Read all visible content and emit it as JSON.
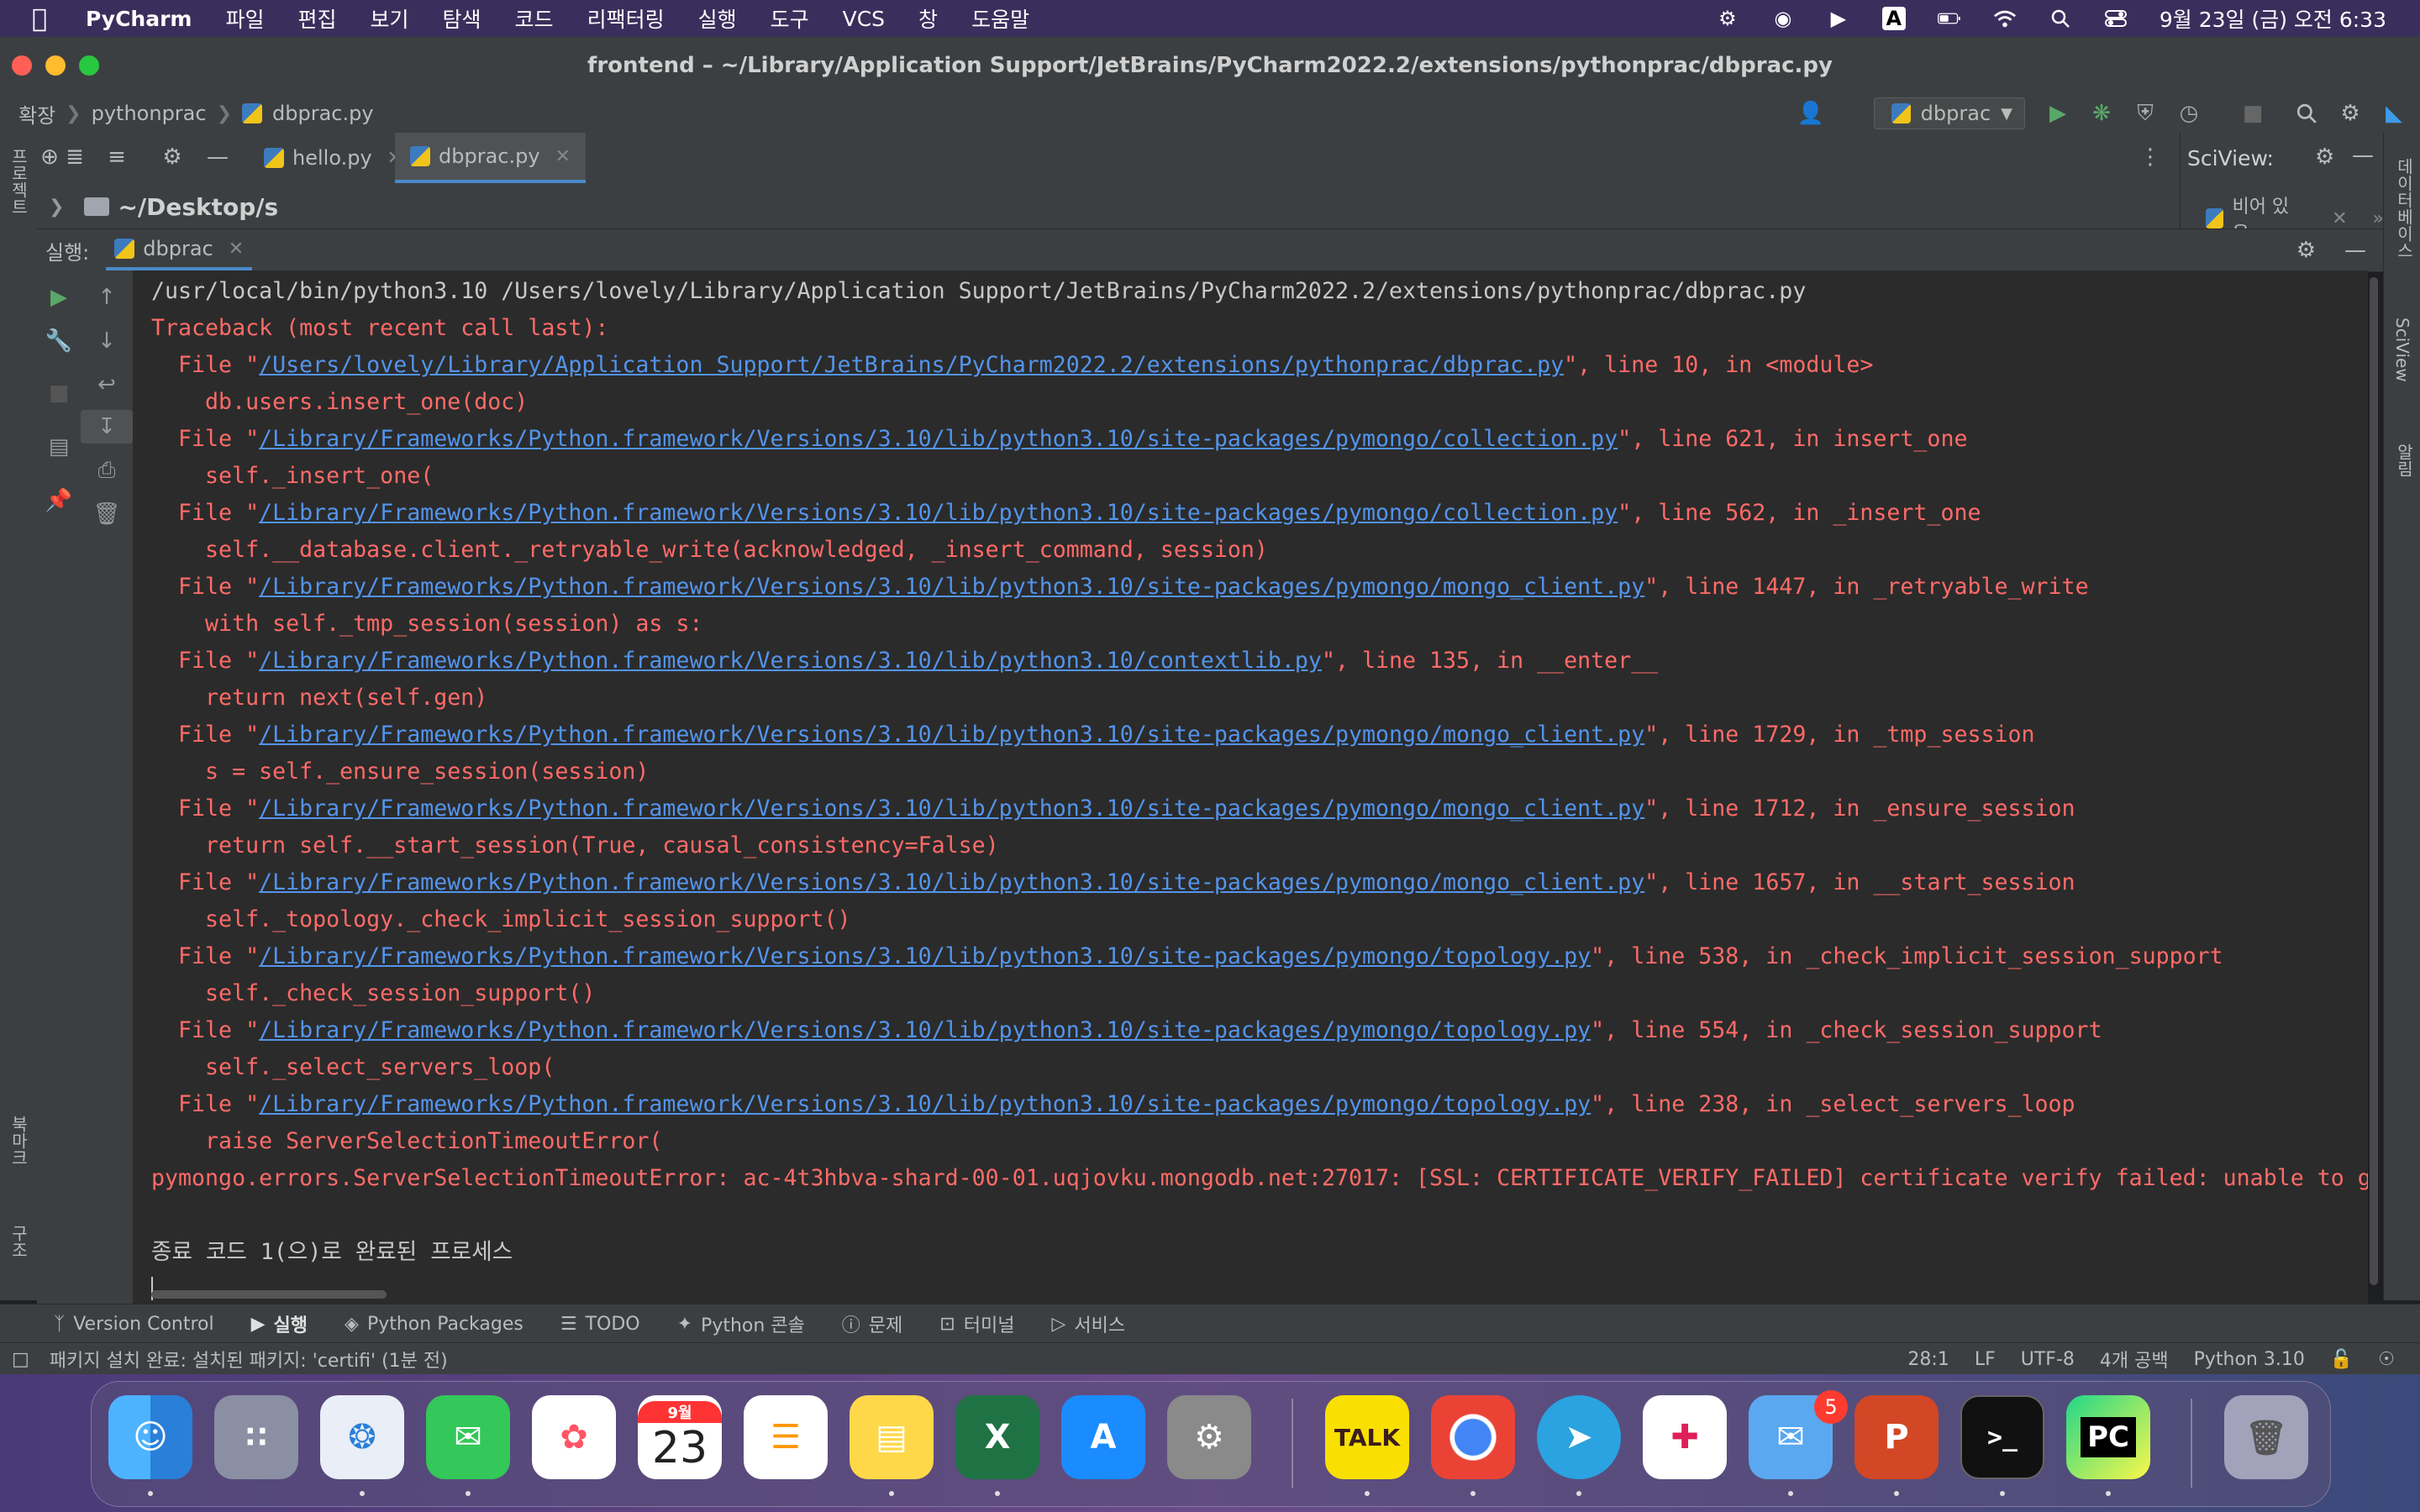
{
  "menubar": {
    "app": "PyCharm",
    "items": [
      "파일",
      "편집",
      "보기",
      "탐색",
      "코드",
      "리팩터링",
      "실행",
      "도구",
      "VCS",
      "창",
      "도움말"
    ],
    "clock": "9월 23일 (금) 오전 6:33",
    "input_source": "A"
  },
  "window": {
    "title": "frontend – ~/Library/Application Support/JetBrains/PyCharm2022.2/extensions/pythonprac/dbprac.py"
  },
  "navbar": {
    "crumbs": [
      "확장",
      "pythonprac",
      "dbprac.py"
    ],
    "run_config": "dbprac"
  },
  "tabs": [
    {
      "label": "hello.py"
    },
    {
      "label": "dbprac.py"
    }
  ],
  "project": {
    "path": "~/Desktop/s"
  },
  "sciview": {
    "title": "SciView:",
    "empty": "비어 있음"
  },
  "left_strip": {
    "project": "프로젝트",
    "bookmarks": "북마크",
    "structure": "구조"
  },
  "right_strip": {
    "database": "데이터베이스",
    "sciview": "SciView",
    "notifications": "알림"
  },
  "run": {
    "label": "실행:",
    "tab": "dbprac",
    "command": "/usr/local/bin/python3.10 /Users/lovely/Library/Application Support/JetBrains/PyCharm2022.2/extensions/pythonprac/dbprac.py",
    "traceback_header": "Traceback (most recent call last):",
    "frames": [
      {
        "path": "/Users/lovely/Library/Application Support/JetBrains/PyCharm2022.2/extensions/pythonprac/dbprac.py",
        "tail": "\", line 10, in <module>",
        "code": "db.users.insert_one(doc)"
      },
      {
        "path": "/Library/Frameworks/Python.framework/Versions/3.10/lib/python3.10/site-packages/pymongo/collection.py",
        "tail": "\", line 621, in insert_one",
        "code": "self._insert_one("
      },
      {
        "path": "/Library/Frameworks/Python.framework/Versions/3.10/lib/python3.10/site-packages/pymongo/collection.py",
        "tail": "\", line 562, in _insert_one",
        "code": "self.__database.client._retryable_write(acknowledged, _insert_command, session)"
      },
      {
        "path": "/Library/Frameworks/Python.framework/Versions/3.10/lib/python3.10/site-packages/pymongo/mongo_client.py",
        "tail": "\", line 1447, in _retryable_write",
        "code": "with self._tmp_session(session) as s:"
      },
      {
        "path": "/Library/Frameworks/Python.framework/Versions/3.10/lib/python3.10/contextlib.py",
        "tail": "\", line 135, in __enter__",
        "code": "return next(self.gen)"
      },
      {
        "path": "/Library/Frameworks/Python.framework/Versions/3.10/lib/python3.10/site-packages/pymongo/mongo_client.py",
        "tail": "\", line 1729, in _tmp_session",
        "code": "s = self._ensure_session(session)"
      },
      {
        "path": "/Library/Frameworks/Python.framework/Versions/3.10/lib/python3.10/site-packages/pymongo/mongo_client.py",
        "tail": "\", line 1712, in _ensure_session",
        "code": "return self.__start_session(True, causal_consistency=False)"
      },
      {
        "path": "/Library/Frameworks/Python.framework/Versions/3.10/lib/python3.10/site-packages/pymongo/mongo_client.py",
        "tail": "\", line 1657, in __start_session",
        "code": "self._topology._check_implicit_session_support()"
      },
      {
        "path": "/Library/Frameworks/Python.framework/Versions/3.10/lib/python3.10/site-packages/pymongo/topology.py",
        "tail": "\", line 538, in _check_implicit_session_support",
        "code": "self._check_session_support()"
      },
      {
        "path": "/Library/Frameworks/Python.framework/Versions/3.10/lib/python3.10/site-packages/pymongo/topology.py",
        "tail": "\", line 554, in _check_session_support",
        "code": "self._select_servers_loop("
      },
      {
        "path": "/Library/Frameworks/Python.framework/Versions/3.10/lib/python3.10/site-packages/pymongo/topology.py",
        "tail": "\", line 238, in _select_servers_loop",
        "code": "raise ServerSelectionTimeoutError("
      }
    ],
    "error": "pymongo.errors.ServerSelectionTimeoutError: ac-4t3hbva-shard-00-01.uqjovku.mongodb.net:27017: [SSL: CERTIFICATE_VERIFY_FAILED] certificate verify failed: unable to ge",
    "exit": "종료 코드 1(으)로 완료된 프로세스"
  },
  "bottom_tabs": [
    "Version Control",
    "실행",
    "Python Packages",
    "TODO",
    "Python 콘솔",
    "문제",
    "터미널",
    "서비스"
  ],
  "status": {
    "message": "패키지 설치 완료: 설치된 패키지: 'certifi' (1분 전)",
    "position": "28:1",
    "line_sep": "LF",
    "encoding": "UTF-8",
    "indent": "4개 공백",
    "interpreter": "Python 3.10"
  },
  "dock": {
    "calendar_month": "9월",
    "calendar_day": "23",
    "talk": "TALK",
    "mail_badge": "5",
    "terminal": ">_",
    "pycharm": "PC"
  }
}
